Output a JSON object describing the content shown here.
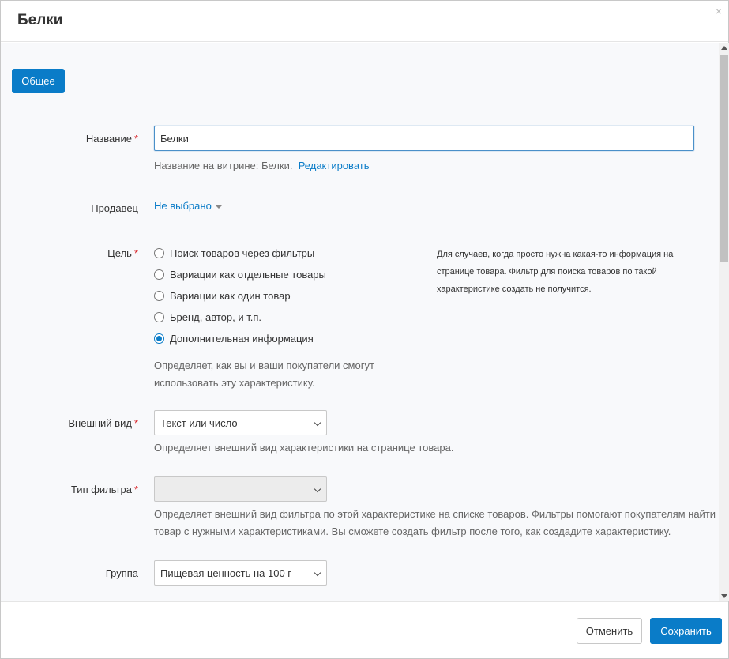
{
  "modal": {
    "title": "Белки",
    "close_symbol": "×"
  },
  "tabs": [
    {
      "label": "Общее",
      "active": true
    }
  ],
  "form": {
    "name": {
      "label": "Название",
      "required_mark": "*",
      "value": "Белки",
      "storefront_prefix": "Название на витрине: Белки.",
      "edit_link": "Редактировать"
    },
    "seller": {
      "label": "Продавец",
      "value": "Не выбрано"
    },
    "purpose": {
      "label": "Цель",
      "required_mark": "*",
      "options": [
        {
          "label": "Поиск товаров через фильтры",
          "checked": false
        },
        {
          "label": "Вариации как отдельные товары",
          "checked": false
        },
        {
          "label": "Вариации как один товар",
          "checked": false
        },
        {
          "label": "Бренд, автор, и т.п.",
          "checked": false
        },
        {
          "label": "Дополнительная информация",
          "checked": true
        }
      ],
      "hint_line1": "Определяет, как вы и ваши покупатели смогут",
      "hint_line2": "использовать эту характеристику.",
      "note_line1": "Для случаев, когда просто нужна какая-то информация на",
      "note_line2": "странице товара. Фильтр для поиска товаров по такой",
      "note_line3": "характеристике создать не получится."
    },
    "appearance": {
      "label": "Внешний вид",
      "required_mark": "*",
      "value": "Текст или число",
      "hint": "Определяет внешний вид характеристики на странице товара."
    },
    "filter_type": {
      "label": "Тип фильтра",
      "required_mark": "*",
      "value": "",
      "hint_line1": "Определяет внешний вид фильтра по этой характеристике на списке товаров. Фильтры помогают покупателям найти",
      "hint_line2": "товар с нужными характеристиками. Вы сможете создать фильтр после того, как создадите характеристику."
    },
    "group": {
      "label": "Группа",
      "value": "Пищевая ценность на 100 г"
    }
  },
  "footer": {
    "cancel_label": "Отменить",
    "save_label": "Сохранить"
  },
  "colors": {
    "accent": "#0a7cc8",
    "required": "#d9262b"
  }
}
